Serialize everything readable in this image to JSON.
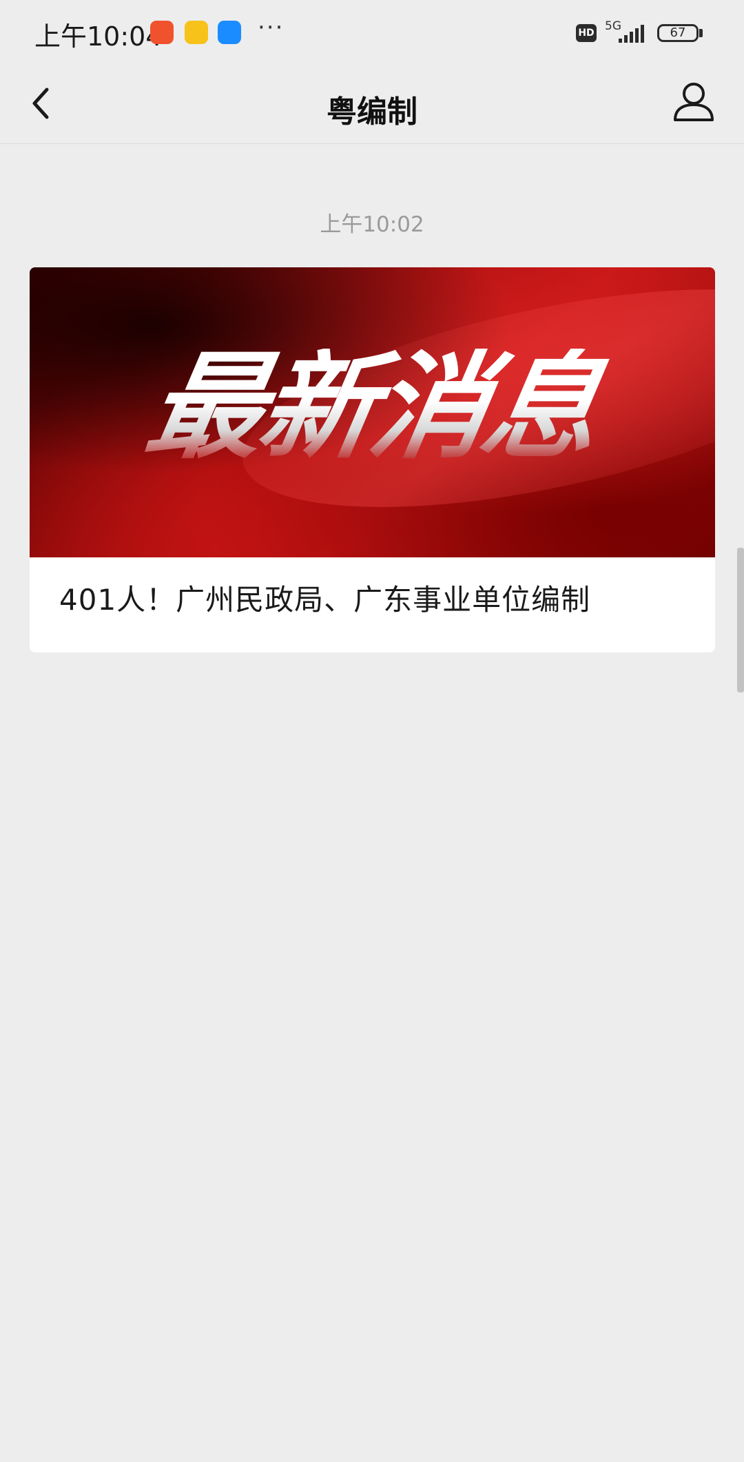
{
  "status_bar": {
    "time": "上午10:04",
    "more": "···",
    "hd": "HD",
    "network": "5G",
    "battery": "67",
    "notification_icons": [
      "app-icon",
      "weibo-icon",
      "message-app-icon"
    ]
  },
  "nav": {
    "title": "粤编制",
    "back_icon": "chevron-left-icon",
    "profile_icon": "person-icon"
  },
  "conversation": {
    "timestamp": "上午10:02",
    "article": {
      "cover_text": "最新消息",
      "title": "401人！广州民政局、广东事业单位编制"
    }
  },
  "colors": {
    "background": "#ededed",
    "card": "#ffffff",
    "cover_red": "#c81616"
  }
}
